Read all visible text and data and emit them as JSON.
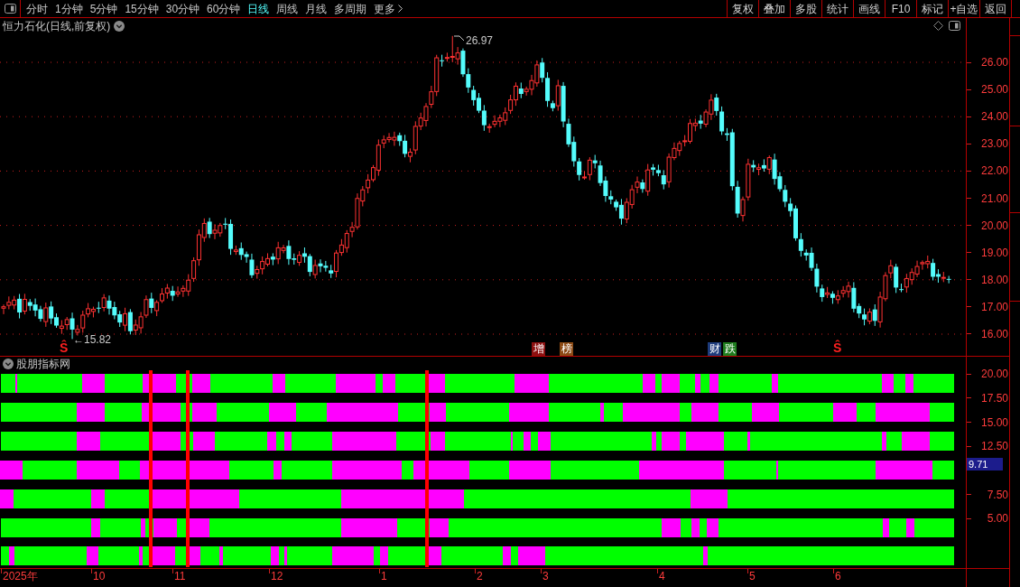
{
  "toolbar": {
    "periods": [
      {
        "label": "分时",
        "kind": "period",
        "selected": false
      },
      {
        "label": "1分钟",
        "kind": "period",
        "selected": false
      },
      {
        "label": "5分钟",
        "kind": "period",
        "selected": false
      },
      {
        "label": "15分钟",
        "kind": "period",
        "selected": false
      },
      {
        "label": "30分钟",
        "kind": "period",
        "selected": false
      },
      {
        "label": "60分钟",
        "kind": "period",
        "selected": false
      },
      {
        "label": "日线",
        "kind": "period",
        "selected": true
      },
      {
        "label": "周线",
        "kind": "period",
        "selected": false
      },
      {
        "label": "月线",
        "kind": "period",
        "selected": false
      },
      {
        "label": "多周期",
        "kind": "period",
        "selected": false
      },
      {
        "label": "更多",
        "kind": "menu",
        "selected": false
      }
    ],
    "actions": [
      "复权",
      "叠加",
      "多股",
      "统计",
      "画线",
      "F10",
      "标记",
      "+自选",
      "返回"
    ]
  },
  "price_chart": {
    "title": "恒力石化(日线,前复权)",
    "high_label": "26.97",
    "low_label": "←15.82",
    "event_markers": [
      {
        "kind": "signal",
        "label": "Ŝ"
      },
      {
        "kind": "tag",
        "label": "增",
        "color": "#8c1010"
      },
      {
        "kind": "tag",
        "label": "榜",
        "color": "#8c4a14"
      },
      {
        "kind": "tag",
        "label": "财",
        "color": "#1e3c7c"
      },
      {
        "kind": "tag",
        "label": "跌",
        "color": "#1e7c1e"
      },
      {
        "kind": "signal",
        "label": "Ŝ"
      }
    ],
    "price_axis": [
      "26.00",
      "25.00",
      "24.00",
      "23.00",
      "22.00",
      "21.00",
      "20.00",
      "19.00",
      "18.00",
      "17.00",
      "16.00"
    ]
  },
  "indicator": {
    "title": "股朋指标网",
    "axis": [
      {
        "kind": "tick",
        "label": "20.00"
      },
      {
        "kind": "tick",
        "label": "17.50"
      },
      {
        "kind": "tick",
        "label": "15.00"
      },
      {
        "kind": "tick",
        "label": "12.50"
      },
      {
        "kind": "current",
        "label": "9.71"
      },
      {
        "kind": "tick",
        "label": "7.50"
      },
      {
        "kind": "tick",
        "label": "5.00"
      }
    ]
  },
  "time_axis": [
    "2025年",
    "10",
    "11",
    "12",
    "1",
    "2",
    "3",
    "4",
    "5",
    "6"
  ]
}
